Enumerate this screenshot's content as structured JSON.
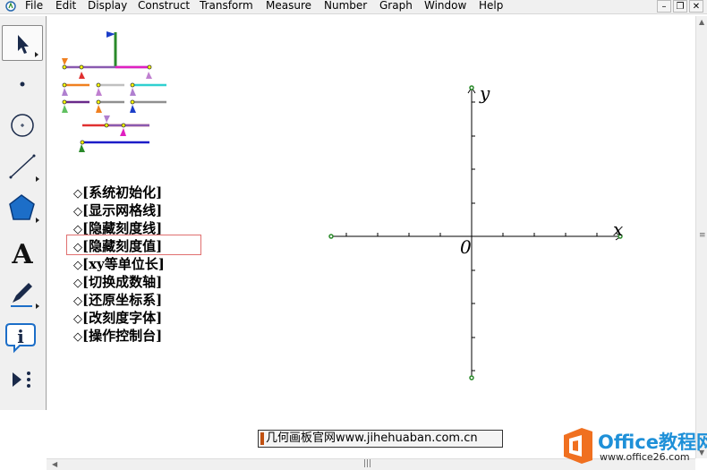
{
  "menubar": {
    "items": [
      "File",
      "Edit",
      "Display",
      "Construct",
      "Transform",
      "Measure",
      "Number",
      "Graph",
      "Window",
      "Help"
    ]
  },
  "window_controls": {
    "minimize": "–",
    "restore": "❐",
    "close": "✕"
  },
  "toolbox": {
    "tools": [
      {
        "name": "arrow-tool-icon"
      },
      {
        "name": "point-tool-icon"
      },
      {
        "name": "compass-tool-icon"
      },
      {
        "name": "straightedge-tool-icon"
      },
      {
        "name": "polygon-tool-icon"
      },
      {
        "name": "text-tool-icon",
        "glyph": "A"
      },
      {
        "name": "marker-tool-icon"
      },
      {
        "name": "information-tool-icon",
        "glyph": "i"
      },
      {
        "name": "custom-tool-icon"
      }
    ]
  },
  "buttons": [
    {
      "diamond": "◇",
      "label": "[系统初始化]"
    },
    {
      "diamond": "◇",
      "label": "[显示网格线]"
    },
    {
      "diamond": "◇",
      "label": "[隐藏刻度线]"
    },
    {
      "diamond": "◇",
      "label": "[隐藏刻度值]"
    },
    {
      "diamond": "◇",
      "label": "[xy等单位长]"
    },
    {
      "diamond": "◇",
      "label": "[切换成数轴]"
    },
    {
      "diamond": "◇",
      "label": "[还原坐标系]"
    },
    {
      "diamond": "◇",
      "label": "[改刻度字体]"
    },
    {
      "diamond": "◇",
      "label": "[操作控制台]"
    }
  ],
  "axes": {
    "x_label": "x",
    "y_label": "y",
    "origin_label": "0"
  },
  "watermark": {
    "caption": "几何画板官网www.jihehuaban.com.cn"
  },
  "logo": {
    "name": "Office教程网",
    "url": "www.office26.com"
  },
  "colors": {
    "accent": "#1e90d8",
    "highlight": "#e07070",
    "axis_point": "#2a8a2a"
  }
}
